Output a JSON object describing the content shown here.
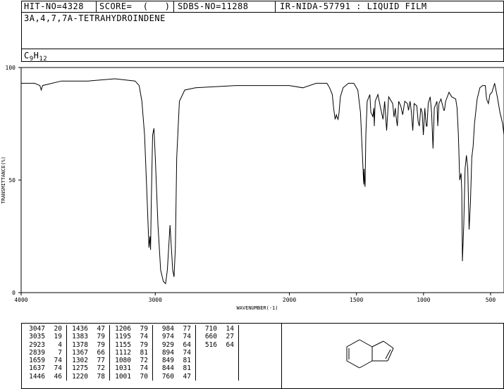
{
  "header": {
    "hit_no": "HIT-NO=4328",
    "score": "SCORE=  (   )",
    "sdbs_no": "SDBS-NO=11288",
    "ir_nida": "IR-NIDA-57791 : LIQUID FILM",
    "compound_name": "3A,4,7,7A-TETRAHYDROINDENE",
    "formula_main": "C",
    "formula_sub1": "9",
    "formula_h": "H",
    "formula_sub2": "12"
  },
  "chart_data": {
    "type": "line",
    "xlabel": "WAVENUMBER(-1)",
    "ylabel": "TRANSMITTANCE(%)",
    "xlim": [
      4000,
      400
    ],
    "ylim": [
      0,
      100
    ],
    "x_ticks": [
      4000,
      3000,
      2000,
      1500,
      1000,
      500
    ],
    "y_ticks": [
      0,
      50,
      100
    ],
    "x_tick_labels": [
      "4000",
      "3000",
      "2000",
      "1500",
      "1000",
      "500"
    ],
    "y_tick_labels": [
      "0",
      "50",
      "100"
    ],
    "series": [
      {
        "points": [
          [
            4000,
            93
          ],
          [
            3900,
            93
          ],
          [
            3860,
            92
          ],
          [
            3850,
            90
          ],
          [
            3840,
            92
          ],
          [
            3700,
            94
          ],
          [
            3500,
            94
          ],
          [
            3300,
            95
          ],
          [
            3150,
            94
          ],
          [
            3120,
            92
          ],
          [
            3100,
            85
          ],
          [
            3080,
            70
          ],
          [
            3060,
            40
          ],
          [
            3047,
            20
          ],
          [
            3040,
            25
          ],
          [
            3035,
            19
          ],
          [
            3030,
            40
          ],
          [
            3020,
            70
          ],
          [
            3010,
            73
          ],
          [
            3000,
            60
          ],
          [
            2980,
            30
          ],
          [
            2960,
            10
          ],
          [
            2940,
            5
          ],
          [
            2923,
            4
          ],
          [
            2910,
            10
          ],
          [
            2890,
            30
          ],
          [
            2880,
            20
          ],
          [
            2870,
            10
          ],
          [
            2860,
            7
          ],
          [
            2850,
            20
          ],
          [
            2840,
            60
          ],
          [
            2820,
            85
          ],
          [
            2780,
            90
          ],
          [
            2700,
            91
          ],
          [
            2400,
            92
          ],
          [
            2300,
            92
          ],
          [
            2000,
            92
          ],
          [
            1900,
            91
          ],
          [
            1800,
            93
          ],
          [
            1720,
            93
          ],
          [
            1700,
            91
          ],
          [
            1680,
            88
          ],
          [
            1670,
            82
          ],
          [
            1659,
            77
          ],
          [
            1650,
            79
          ],
          [
            1645,
            78
          ],
          [
            1637,
            77
          ],
          [
            1630,
            80
          ],
          [
            1620,
            87
          ],
          [
            1600,
            91
          ],
          [
            1560,
            93
          ],
          [
            1520,
            93
          ],
          [
            1490,
            90
          ],
          [
            1470,
            80
          ],
          [
            1455,
            60
          ],
          [
            1446,
            48
          ],
          [
            1443,
            55
          ],
          [
            1440,
            50
          ],
          [
            1436,
            47
          ],
          [
            1430,
            70
          ],
          [
            1420,
            85
          ],
          [
            1400,
            88
          ],
          [
            1393,
            80
          ],
          [
            1383,
            79
          ],
          [
            1378,
            78
          ],
          [
            1370,
            82
          ],
          [
            1367,
            74
          ],
          [
            1360,
            85
          ],
          [
            1340,
            88
          ],
          [
            1320,
            82
          ],
          [
            1302,
            77
          ],
          [
            1290,
            85
          ],
          [
            1275,
            72
          ],
          [
            1260,
            87
          ],
          [
            1230,
            84
          ],
          [
            1220,
            78
          ],
          [
            1210,
            82
          ],
          [
            1206,
            79
          ],
          [
            1200,
            76
          ],
          [
            1195,
            74
          ],
          [
            1185,
            85
          ],
          [
            1170,
            83
          ],
          [
            1155,
            79
          ],
          [
            1140,
            85
          ],
          [
            1120,
            84
          ],
          [
            1112,
            81
          ],
          [
            1100,
            85
          ],
          [
            1090,
            80
          ],
          [
            1080,
            72
          ],
          [
            1070,
            84
          ],
          [
            1050,
            83
          ],
          [
            1040,
            76
          ],
          [
            1031,
            74
          ],
          [
            1020,
            82
          ],
          [
            1010,
            80
          ],
          [
            1001,
            70
          ],
          [
            990,
            82
          ],
          [
            984,
            77
          ],
          [
            979,
            74
          ],
          [
            974,
            74
          ],
          [
            965,
            84
          ],
          [
            950,
            87
          ],
          [
            940,
            80
          ],
          [
            929,
            64
          ],
          [
            920,
            82
          ],
          [
            900,
            85
          ],
          [
            894,
            74
          ],
          [
            885,
            84
          ],
          [
            870,
            86
          ],
          [
            849,
            81
          ],
          [
            844,
            81
          ],
          [
            835,
            85
          ],
          [
            810,
            89
          ],
          [
            790,
            87
          ],
          [
            760,
            86
          ],
          [
            750,
            82
          ],
          [
            740,
            70
          ],
          [
            730,
            50
          ],
          [
            720,
            53
          ],
          [
            715,
            45
          ],
          [
            710,
            14
          ],
          [
            700,
            30
          ],
          [
            690,
            55
          ],
          [
            680,
            61
          ],
          [
            670,
            55
          ],
          [
            660,
            28
          ],
          [
            650,
            40
          ],
          [
            640,
            60
          ],
          [
            630,
            65
          ],
          [
            620,
            75
          ],
          [
            600,
            86
          ],
          [
            580,
            91
          ],
          [
            560,
            92
          ],
          [
            540,
            92
          ],
          [
            530,
            86
          ],
          [
            516,
            84
          ],
          [
            505,
            88
          ],
          [
            490,
            89
          ],
          [
            470,
            93
          ],
          [
            450,
            87
          ],
          [
            430,
            80
          ],
          [
            410,
            75
          ],
          [
            400,
            70
          ]
        ]
      }
    ],
    "peak_table": [
      [
        "3047",
        "20",
        "1436",
        "47",
        "1206",
        "79",
        "984",
        "77",
        "710",
        "14"
      ],
      [
        "3035",
        "19",
        "1383",
        "79",
        "1195",
        "74",
        "974",
        "74",
        "660",
        "27"
      ],
      [
        "2923",
        "4",
        "1378",
        "79",
        "1155",
        "79",
        "929",
        "64",
        "516",
        "64"
      ],
      [
        "2839",
        "7",
        "1367",
        "66",
        "1112",
        "81",
        "894",
        "74",
        "",
        ""
      ],
      [
        "1659",
        "74",
        "1302",
        "77",
        "1080",
        "72",
        "849",
        "81",
        "",
        ""
      ],
      [
        "1637",
        "74",
        "1275",
        "72",
        "1031",
        "74",
        "844",
        "81",
        "",
        ""
      ],
      [
        "1446",
        "46",
        "1220",
        "78",
        "1001",
        "70",
        "760",
        "47",
        "",
        ""
      ]
    ]
  }
}
